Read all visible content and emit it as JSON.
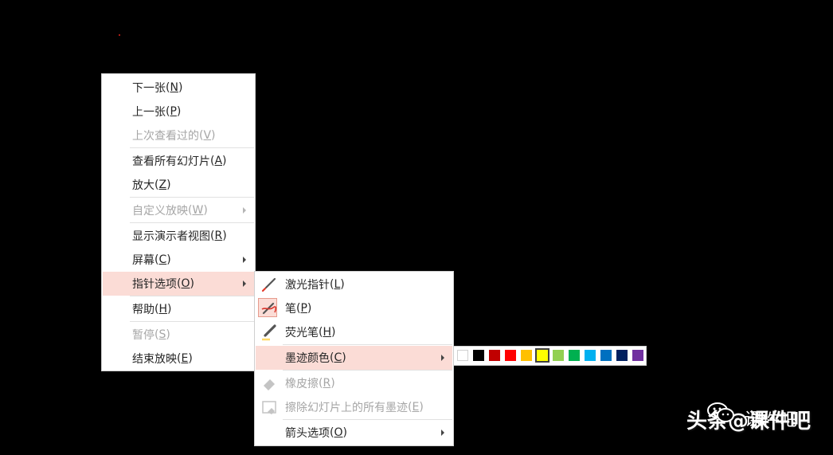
{
  "main_menu": {
    "items": [
      {
        "label": "下一张",
        "key": "N",
        "enabled": true
      },
      {
        "label": "上一张",
        "key": "P",
        "enabled": true
      },
      {
        "label": "上次查看过的",
        "key": "V",
        "enabled": false
      },
      {
        "label": "查看所有幻灯片",
        "key": "A",
        "enabled": true
      },
      {
        "label": "放大",
        "key": "Z",
        "enabled": true
      },
      {
        "label": "自定义放映",
        "key": "W",
        "enabled": false
      },
      {
        "label": "显示演示者视图",
        "key": "R",
        "enabled": true
      },
      {
        "label": "屏幕",
        "key": "C",
        "enabled": true
      },
      {
        "label": "指针选项",
        "key": "O",
        "enabled": true,
        "highlighted": true
      },
      {
        "label": "帮助",
        "key": "H",
        "enabled": true
      },
      {
        "label": "暂停",
        "key": "S",
        "enabled": false
      },
      {
        "label": "结束放映",
        "key": "E",
        "enabled": true
      }
    ]
  },
  "pointer_menu": {
    "items": [
      {
        "label": "激光指针",
        "key": "L",
        "icon": "laser-pointer-icon",
        "enabled": true
      },
      {
        "label": "笔",
        "key": "P",
        "icon": "pen-icon",
        "enabled": true,
        "checked": true
      },
      {
        "label": "荧光笔",
        "key": "H",
        "icon": "highlighter-icon",
        "enabled": true
      },
      {
        "label": "墨迹颜色",
        "key": "C",
        "enabled": true,
        "highlighted": true
      },
      {
        "label": "橡皮擦",
        "key": "R",
        "icon": "eraser-icon",
        "enabled": false
      },
      {
        "label": "擦除幻灯片上的所有墨迹",
        "key": "E",
        "icon": "erase-all-icon",
        "enabled": false
      },
      {
        "label": "箭头选项",
        "key": "O",
        "enabled": true
      }
    ]
  },
  "ink_colors": {
    "swatches": [
      "#ffffff",
      "#000000",
      "#c00000",
      "#ff0000",
      "#ffc000",
      "#ffff00",
      "#92d050",
      "#00b050",
      "#00b0f0",
      "#0070c0",
      "#002060",
      "#7030a0"
    ],
    "selected_index": 5
  },
  "watermark": {
    "prefix": "头条",
    "handle": "@课件吧",
    "title": "课件吧"
  }
}
